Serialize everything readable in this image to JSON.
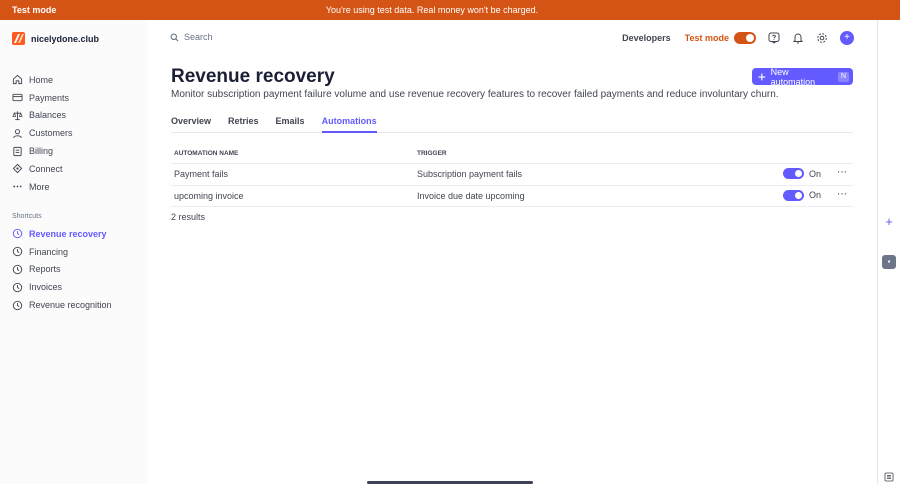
{
  "banner": {
    "mode": "Test mode",
    "message": "You're using test data. Real money won't be charged."
  },
  "account": {
    "name": "nicelydone.club"
  },
  "search": {
    "placeholder": "Search"
  },
  "topbar": {
    "developers": "Developers",
    "test_mode": "Test mode"
  },
  "nav": {
    "items": [
      {
        "label": "Home",
        "icon": "home-icon"
      },
      {
        "label": "Payments",
        "icon": "payments-icon"
      },
      {
        "label": "Balances",
        "icon": "balances-icon"
      },
      {
        "label": "Customers",
        "icon": "customers-icon"
      },
      {
        "label": "Billing",
        "icon": "billing-icon"
      },
      {
        "label": "Connect",
        "icon": "connect-icon"
      },
      {
        "label": "More",
        "icon": "more-icon"
      }
    ],
    "shortcuts_label": "Shortcuts",
    "shortcuts": [
      {
        "label": "Revenue recovery",
        "active": true
      },
      {
        "label": "Financing"
      },
      {
        "label": "Reports"
      },
      {
        "label": "Invoices"
      },
      {
        "label": "Revenue recognition"
      }
    ]
  },
  "page": {
    "title": "Revenue recovery",
    "subtitle": "Monitor subscription payment failure volume and use revenue recovery features to recover failed payments and reduce involuntary churn.",
    "new_button": "New automation",
    "new_button_shortcut": "N"
  },
  "tabs": [
    {
      "label": "Overview"
    },
    {
      "label": "Retries"
    },
    {
      "label": "Emails"
    },
    {
      "label": "Automations",
      "active": true
    }
  ],
  "table": {
    "headers": [
      "AUTOMATION NAME",
      "TRIGGER"
    ],
    "rows": [
      {
        "name": "Payment fails",
        "trigger": "Subscription payment fails",
        "status": "On"
      },
      {
        "name": "upcoming invoice",
        "trigger": "Invoice due date upcoming",
        "status": "On"
      }
    ],
    "results": "2 results"
  },
  "colors": {
    "accent": "#635bff",
    "test_mode": "#d45415"
  }
}
